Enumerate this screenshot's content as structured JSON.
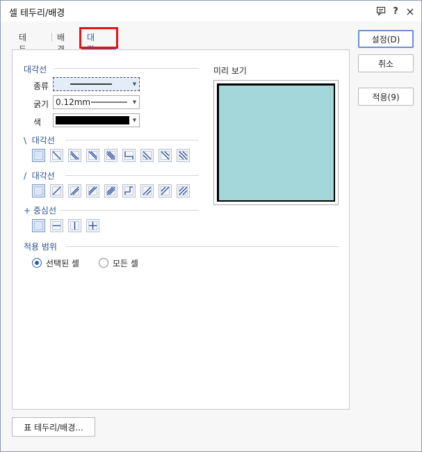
{
  "window": {
    "title": "셀 테두리/배경"
  },
  "titlebar": {
    "comment_icon": "comment-icon",
    "help_label": "?",
    "close_label": "×"
  },
  "tabs": [
    {
      "label": "테두리",
      "active": false
    },
    {
      "label": "배경",
      "active": false
    },
    {
      "label": "대각선",
      "active": true
    }
  ],
  "diagonal_section": {
    "title": "대각선",
    "type_label": "종류",
    "thickness_label": "굵기",
    "thickness_value": "0.12mm",
    "color_label": "색",
    "color_value": "#000000"
  },
  "backslash_section": {
    "prefix": "\\",
    "title": "대각선",
    "button_count_selected": 1
  },
  "slash_section": {
    "prefix": "/",
    "title": "대각선"
  },
  "center_section": {
    "prefix": "+",
    "title": "중심선"
  },
  "apply_scope": {
    "title": "적용 범위",
    "options": [
      {
        "label": "선택된 셀",
        "checked": true
      },
      {
        "label": "모든 셀",
        "checked": false
      }
    ]
  },
  "preview": {
    "title": "미리 보기",
    "cell_color": "#a3d7da"
  },
  "buttons": {
    "ok": "설정(D)",
    "cancel": "취소",
    "apply": "적용(9)",
    "table_border": "표 테두리/배경..."
  },
  "colors": {
    "accent": "#2a5db0",
    "highlight": "#e31515"
  }
}
